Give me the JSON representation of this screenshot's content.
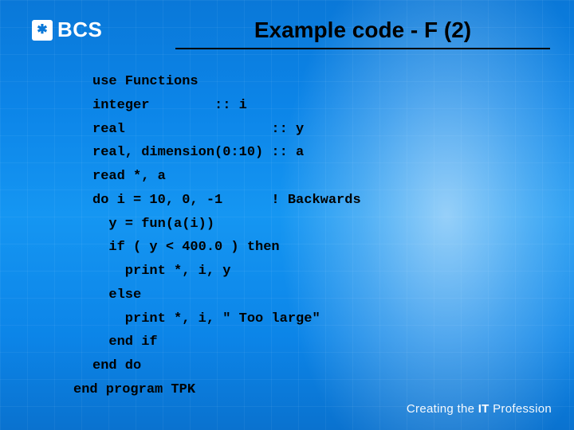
{
  "logo": {
    "badge_glyph": "✱",
    "text": "BCS"
  },
  "title": "Example code - F  (2)",
  "code": {
    "l01": "use Functions",
    "l02": "integer        :: i",
    "l03": "real                  :: y",
    "l04": "real, dimension(0:10) :: a",
    "l05": "read *, a",
    "l06": "do i = 10, 0, -1      ! Backwards",
    "l07": "  y = fun(a(i))",
    "l08": "  if ( y < 400.0 ) then",
    "l09": "    print *, i, y",
    "l10": "  else",
    "l11": "    print *, i, \" Too large\"",
    "l12": "  end if",
    "l13": "end do",
    "l14_outdent": "end program TPK"
  },
  "tagline": {
    "prefix": "Creating the ",
    "bold": "IT",
    "suffix": " Profession"
  }
}
